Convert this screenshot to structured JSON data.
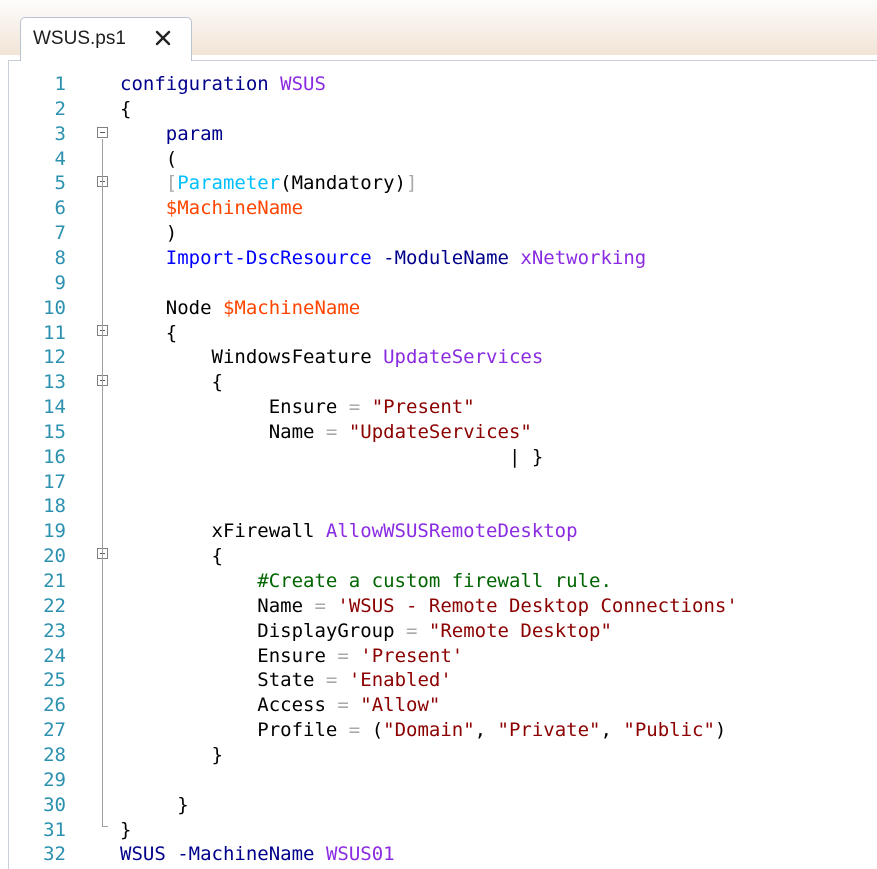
{
  "tab": {
    "title": "WSUS.ps1",
    "close_icon": "close-icon"
  },
  "lines": [
    {
      "n": "1",
      "indent": "",
      "tokens": [
        [
          "kw",
          "configuration"
        ],
        [
          "plain",
          " "
        ],
        [
          "arg",
          "WSUS"
        ]
      ]
    },
    {
      "n": "2",
      "indent": "",
      "tokens": [
        [
          "plain",
          "{"
        ]
      ]
    },
    {
      "n": "3",
      "indent": "    ",
      "tokens": [
        [
          "kw",
          "param"
        ]
      ]
    },
    {
      "n": "4",
      "indent": "    ",
      "tokens": [
        [
          "plain",
          "("
        ]
      ]
    },
    {
      "n": "5",
      "indent": "    ",
      "tokens": [
        [
          "op",
          "["
        ],
        [
          "attr",
          "Parameter"
        ],
        [
          "plain",
          "(Mandatory)"
        ],
        [
          "op",
          "]"
        ]
      ]
    },
    {
      "n": "6",
      "indent": "    ",
      "tokens": [
        [
          "var",
          "$MachineName"
        ]
      ]
    },
    {
      "n": "7",
      "indent": "    ",
      "tokens": [
        [
          "plain",
          ")"
        ]
      ]
    },
    {
      "n": "8",
      "indent": "    ",
      "tokens": [
        [
          "fn",
          "Import-DscResource"
        ],
        [
          "plain",
          " "
        ],
        [
          "kw",
          "-ModuleName"
        ],
        [
          "plain",
          " "
        ],
        [
          "arg",
          "xNetworking"
        ]
      ]
    },
    {
      "n": "9",
      "indent": "",
      "tokens": []
    },
    {
      "n": "10",
      "indent": "    ",
      "tokens": [
        [
          "plain",
          "Node "
        ],
        [
          "var",
          "$MachineName"
        ]
      ]
    },
    {
      "n": "11",
      "indent": "    ",
      "tokens": [
        [
          "plain",
          "{"
        ]
      ]
    },
    {
      "n": "12",
      "indent": "        ",
      "tokens": [
        [
          "plain",
          "WindowsFeature "
        ],
        [
          "arg",
          "UpdateServices"
        ]
      ]
    },
    {
      "n": "13",
      "indent": "        ",
      "tokens": [
        [
          "plain",
          "{"
        ]
      ]
    },
    {
      "n": "14",
      "indent": "             ",
      "tokens": [
        [
          "plain",
          "Ensure "
        ],
        [
          "op",
          "="
        ],
        [
          "plain",
          " "
        ],
        [
          "str",
          "\"Present\""
        ]
      ]
    },
    {
      "n": "15",
      "indent": "             ",
      "tokens": [
        [
          "plain",
          "Name "
        ],
        [
          "op",
          "="
        ],
        [
          "plain",
          " "
        ],
        [
          "str",
          "\"UpdateServices\""
        ]
      ]
    },
    {
      "n": "16",
      "indent": "                                  ",
      "tokens": [
        [
          "plain",
          "| }"
        ]
      ]
    },
    {
      "n": "17",
      "indent": "",
      "tokens": []
    },
    {
      "n": "18",
      "indent": "",
      "tokens": []
    },
    {
      "n": "19",
      "indent": "        ",
      "tokens": [
        [
          "plain",
          "xFirewall "
        ],
        [
          "arg",
          "AllowWSUSRemoteDesktop"
        ]
      ]
    },
    {
      "n": "20",
      "indent": "        ",
      "tokens": [
        [
          "plain",
          "{"
        ]
      ]
    },
    {
      "n": "21",
      "indent": "            ",
      "tokens": [
        [
          "cm",
          "#Create a custom firewall rule."
        ]
      ]
    },
    {
      "n": "22",
      "indent": "            ",
      "tokens": [
        [
          "plain",
          "Name "
        ],
        [
          "op",
          "="
        ],
        [
          "plain",
          " "
        ],
        [
          "str",
          "'WSUS - Remote Desktop Connections'"
        ]
      ]
    },
    {
      "n": "23",
      "indent": "            ",
      "tokens": [
        [
          "plain",
          "DisplayGroup "
        ],
        [
          "op",
          "="
        ],
        [
          "plain",
          " "
        ],
        [
          "str",
          "\"Remote Desktop\""
        ]
      ]
    },
    {
      "n": "24",
      "indent": "            ",
      "tokens": [
        [
          "plain",
          "Ensure "
        ],
        [
          "op",
          "="
        ],
        [
          "plain",
          " "
        ],
        [
          "str",
          "'Present'"
        ]
      ]
    },
    {
      "n": "25",
      "indent": "            ",
      "tokens": [
        [
          "plain",
          "State "
        ],
        [
          "op",
          "="
        ],
        [
          "plain",
          " "
        ],
        [
          "str",
          "'Enabled'"
        ]
      ]
    },
    {
      "n": "26",
      "indent": "            ",
      "tokens": [
        [
          "plain",
          "Access "
        ],
        [
          "op",
          "="
        ],
        [
          "plain",
          " "
        ],
        [
          "str",
          "\"Allow\""
        ]
      ]
    },
    {
      "n": "27",
      "indent": "            ",
      "tokens": [
        [
          "plain",
          "Profile "
        ],
        [
          "op",
          "="
        ],
        [
          "plain",
          " ("
        ],
        [
          "str",
          "\"Domain\""
        ],
        [
          "plain",
          ", "
        ],
        [
          "str",
          "\"Private\""
        ],
        [
          "plain",
          ", "
        ],
        [
          "str",
          "\"Public\""
        ],
        [
          "plain",
          ")"
        ]
      ]
    },
    {
      "n": "28",
      "indent": "        ",
      "tokens": [
        [
          "plain",
          "}"
        ]
      ]
    },
    {
      "n": "29",
      "indent": "",
      "tokens": []
    },
    {
      "n": "30",
      "indent": "     ",
      "tokens": [
        [
          "plain",
          "}"
        ]
      ]
    },
    {
      "n": "31",
      "indent": "",
      "tokens": [
        [
          "plain",
          "}"
        ]
      ]
    },
    {
      "n": "32",
      "indent": "",
      "tokens": [
        [
          "kw",
          "WSUS"
        ],
        [
          "plain",
          " "
        ],
        [
          "kw",
          "-MachineName"
        ],
        [
          "plain",
          " "
        ],
        [
          "arg",
          "WSUS01"
        ]
      ]
    }
  ]
}
